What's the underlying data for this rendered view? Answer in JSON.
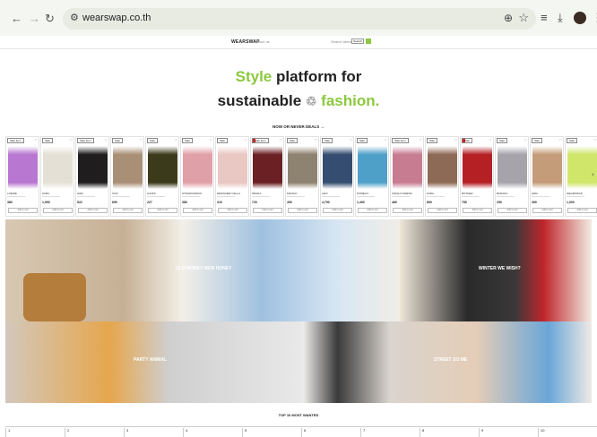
{
  "browser": {
    "url": "wearswap.co.th",
    "icons": [
      "back-icon",
      "forward-icon",
      "reload-icon",
      "tune-icon",
      "zoom-icon",
      "star-icon",
      "media-icon",
      "download-icon",
      "profile-avatar",
      "menu-dots-icon"
    ]
  },
  "site": {
    "brand": "WEARSWAP",
    "menu": "About us",
    "search_placeholder": "Search items",
    "search_button": "Search"
  },
  "hero": {
    "line1_accent": "Style",
    "line1_rest": " platform for",
    "line2_start": "sustainable ",
    "line2_leaf": "♲",
    "line2_accent": " fashion."
  },
  "deals_label": "NOW OR NEVER",
  "deals_rest": " DEALS",
  "deals_arrow": "→",
  "products": [
    {
      "tag": "Sale item",
      "name": "LOEWE",
      "price": "380",
      "button": "Add to cart",
      "color": "#b877d0"
    },
    {
      "tag": "Sale",
      "name": "ZARA",
      "price": "1,990",
      "button": "Add to cart",
      "color": "#e4e0d6"
    },
    {
      "tag": "Sale item",
      "name": "H&M",
      "price": "522",
      "button": "Add to cart",
      "color": "#1f1d1d"
    },
    {
      "tag": "Sale",
      "name": "COS",
      "price": "690",
      "button": "Add to cart",
      "color": "#a98f76"
    },
    {
      "tag": "Sale",
      "name": "GANNI",
      "price": "227",
      "button": "Add to cart",
      "color": "#3b3a1b"
    },
    {
      "tag": "Sale",
      "name": "STRADIVARIUS",
      "price": "380",
      "button": "Add to cart",
      "color": "#e0a0a7"
    },
    {
      "tag": "Sale",
      "name": "DESIGNER CELLA",
      "price": "310",
      "button": "Add to cart",
      "color": "#e9c7c2"
    },
    {
      "tag": "Sale item",
      "name": "PRADA",
      "price": "720",
      "button": "Add to cart",
      "color": "#6b2024",
      "red": true
    },
    {
      "tag": "Sale",
      "name": "MANGO",
      "price": "490",
      "button": "Add to cart",
      "color": "#8e8270"
    },
    {
      "tag": "Sale",
      "name": "LEVI",
      "price": "4,790",
      "button": "Add to cart",
      "color": "#354d70"
    },
    {
      "tag": "Sale",
      "name": "POMELO",
      "price": "1,490",
      "button": "Add to cart",
      "color": "#4fa0c9"
    },
    {
      "tag": "Sale item",
      "name": "UNIQLO DRESS",
      "price": "460",
      "button": "Add to cart",
      "color": "#c77c92"
    },
    {
      "tag": "Sale",
      "name": "ZARA",
      "price": "890",
      "button": "Add to cart",
      "color": "#8d6a56"
    },
    {
      "tag": "Sale",
      "name": "BOTHER",
      "price": "750",
      "button": "Add to cart",
      "color": "#b52025",
      "red": true
    },
    {
      "tag": "Sale",
      "name": "BANANA",
      "price": "250",
      "button": "Add to cart",
      "color": "#a6a4aa"
    },
    {
      "tag": "Sale",
      "name": "H&M",
      "price": "490",
      "button": "Add to cart",
      "color": "#c49c79"
    },
    {
      "tag": "Sale",
      "name": "WEARSWAP",
      "price": "1,000",
      "button": "Add to cart",
      "color": "#cfe66a"
    }
  ],
  "banners": [
    {
      "label": "OLD MONEY NEW HONEY"
    },
    {
      "label": "WINTER WE WISH?"
    },
    {
      "label": "PARTY ANIMAL"
    },
    {
      "label": "STREET SO ME"
    }
  ],
  "top_title": "TOP 10 MOST WANTED",
  "ranks": [
    "1",
    "2",
    "3",
    "4",
    "5",
    "6",
    "7",
    "8",
    "9",
    "10"
  ]
}
